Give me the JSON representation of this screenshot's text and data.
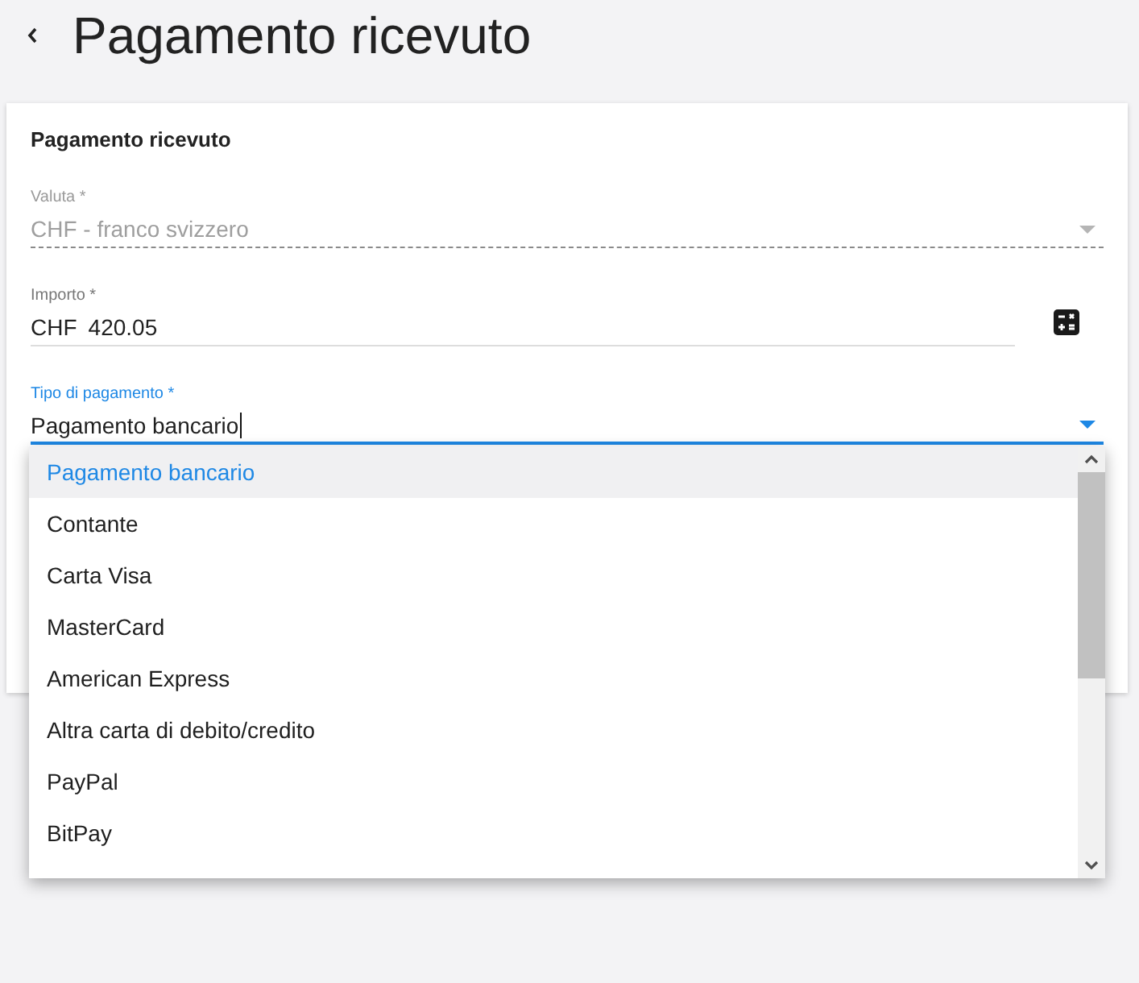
{
  "header": {
    "title": "Pagamento ricevuto"
  },
  "card": {
    "title": "Pagamento ricevuto",
    "fields": [
      {
        "kind": "select",
        "label": "Valuta *",
        "value": "CHF - franco svizzero",
        "disabled": true,
        "focused": false
      },
      {
        "kind": "amount",
        "label": "Importo *",
        "currency": "CHF",
        "value": "420.05",
        "disabled": false,
        "focused": false
      },
      {
        "kind": "select",
        "label": "Tipo di pagamento *",
        "value": "Pagamento bancario",
        "disabled": false,
        "focused": true,
        "options": [
          {
            "label": "Pagamento bancario",
            "selected": true
          },
          {
            "label": "Contante",
            "selected": false
          },
          {
            "label": "Carta Visa",
            "selected": false
          },
          {
            "label": "MasterCard",
            "selected": false
          },
          {
            "label": "American Express",
            "selected": false
          },
          {
            "label": "Altra carta di debito/credito",
            "selected": false
          },
          {
            "label": "PayPal",
            "selected": false
          },
          {
            "label": "BitPay",
            "selected": false
          }
        ]
      }
    ]
  }
}
